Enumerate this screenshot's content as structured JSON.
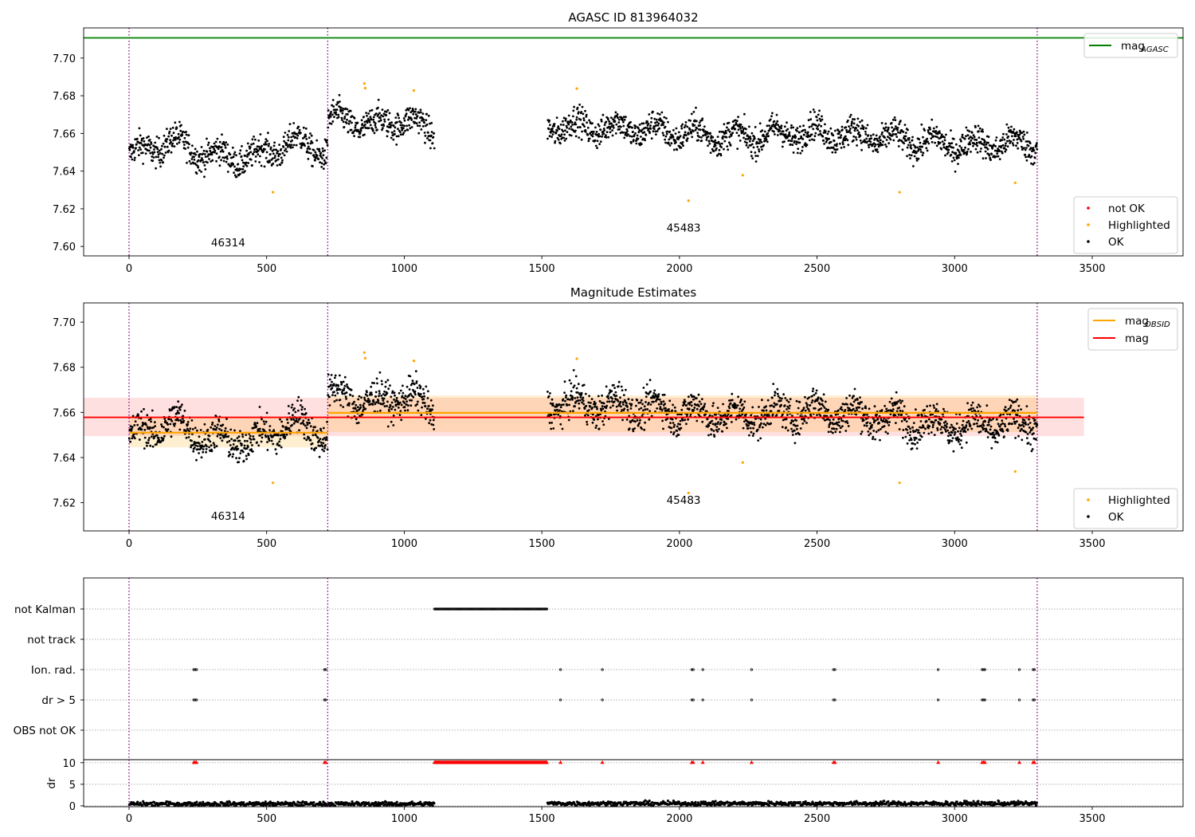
{
  "chart_data": [
    {
      "type": "scatter",
      "title": "AGASC ID 813964032",
      "xlim": [
        -165,
        3830
      ],
      "ylim": [
        7.595,
        7.716
      ],
      "xticks": [
        0,
        500,
        1000,
        1500,
        2000,
        2500,
        3000,
        3500
      ],
      "yticks": [
        7.6,
        7.62,
        7.64,
        7.66,
        7.68,
        7.7
      ],
      "ytick_labels": [
        "7.60",
        "7.62",
        "7.64",
        "7.66",
        "7.68",
        "7.70"
      ],
      "hlines": [
        {
          "name": "mag_AGASC",
          "y": 7.7107,
          "color": "#008000"
        }
      ],
      "obsid_boundaries": [
        0,
        722,
        3300
      ],
      "obsid_labels": [
        {
          "text": "46314",
          "x": 360,
          "y": 7.6
        },
        {
          "text": "45483",
          "x": 2015,
          "y": 7.608
        }
      ],
      "data_segments": [
        {
          "x": [
            0,
            722
          ],
          "mean": 7.6515,
          "spread": 0.0065,
          "drift": [
            [
              0,
              7.648
            ],
            [
              150,
              7.656
            ],
            [
              300,
              7.648
            ],
            [
              450,
              7.647
            ],
            [
              600,
              7.656
            ],
            [
              722,
              7.65
            ]
          ]
        },
        {
          "x": [
            722,
            1110
          ],
          "mean": 7.666,
          "spread": 0.0065,
          "drift": [
            [
              722,
              7.668
            ],
            [
              900,
              7.664
            ],
            [
              1000,
              7.668
            ],
            [
              1110,
              7.66
            ]
          ]
        },
        {
          "x": [
            1520,
            3300
          ],
          "mean": 7.6595,
          "spread": 0.0065,
          "drift": [
            [
              1520,
              7.664
            ],
            [
              1800,
              7.663
            ],
            [
              2200,
              7.658
            ],
            [
              2500,
              7.661
            ],
            [
              3000,
              7.654
            ],
            [
              3300,
              7.655
            ]
          ]
        }
      ],
      "highlighted_points": [
        [
          855,
          7.6865
        ],
        [
          858,
          7.684
        ],
        [
          1035,
          7.6828
        ],
        [
          1627,
          7.6838
        ],
        [
          523,
          7.6288
        ],
        [
          2033,
          7.6243
        ],
        [
          2230,
          7.6378
        ],
        [
          2800,
          7.6288
        ],
        [
          3220,
          7.6338
        ]
      ],
      "legend": {
        "position": "top-right",
        "entries": [
          {
            "label": "mag",
            "sub": "AGASC",
            "color": "#008000",
            "kind": "line"
          }
        ]
      },
      "legend2": {
        "position": "bottom-right",
        "entries": [
          {
            "label": "not OK",
            "color": "#ff0000",
            "kind": "marker"
          },
          {
            "label": "Highlighted",
            "color": "#ffa500",
            "kind": "marker"
          },
          {
            "label": "OK",
            "color": "#000000",
            "kind": "marker"
          }
        ]
      }
    },
    {
      "type": "scatter",
      "title": "Magnitude Estimates",
      "xlim": [
        -165,
        3830
      ],
      "ylim": [
        7.6075,
        7.7085
      ],
      "xticks": [
        0,
        500,
        1000,
        1500,
        2000,
        2500,
        3000,
        3500
      ],
      "yticks": [
        7.62,
        7.64,
        7.66,
        7.68,
        7.7
      ],
      "ytick_labels": [
        "7.62",
        "7.64",
        "7.66",
        "7.68",
        "7.70"
      ],
      "obsid_boundaries": [
        0,
        722,
        3300
      ],
      "obsid_labels": [
        {
          "text": "46314",
          "x": 360,
          "y": 7.6125
        },
        {
          "text": "45483",
          "x": 2015,
          "y": 7.6195
        }
      ],
      "mag": {
        "value": 7.6578,
        "band": [
          7.6495,
          7.6665
        ],
        "x": [
          -165,
          3470
        ],
        "color": "#ff0000"
      },
      "mag_obsid": [
        {
          "x": [
            0,
            722
          ],
          "value": 7.651,
          "band": [
            7.6445,
            7.6575
          ]
        },
        {
          "x": [
            722,
            3300
          ],
          "value": 7.6598,
          "band": [
            7.6513,
            7.6675
          ]
        }
      ],
      "legend": {
        "position": "top-right",
        "entries": [
          {
            "label": "mag",
            "sub": "OBSID",
            "color": "#ffa500",
            "kind": "line"
          },
          {
            "label": "mag",
            "sub": "",
            "color": "#ff0000",
            "kind": "line"
          }
        ]
      },
      "legend2": {
        "position": "bottom-right",
        "entries": [
          {
            "label": "Highlighted",
            "color": "#ffa500",
            "kind": "marker"
          },
          {
            "label": "OK",
            "color": "#000000",
            "kind": "marker"
          }
        ]
      }
    },
    {
      "type": "scatter",
      "title": "",
      "xlim": [
        -165,
        3830
      ],
      "flag_rows": [
        "not Kalman",
        "not track",
        "Ion. rad.",
        "dr > 5",
        "OBS not OK"
      ],
      "flags": {
        "not Kalman": {
          "ranges": [
            [
              1110,
              1520
            ]
          ],
          "points": []
        },
        "not track": {
          "ranges": [],
          "points": []
        },
        "Ion. rad.": {
          "ranges": [],
          "points": [
            235,
            240,
            245,
            710,
            715,
            1568,
            1720,
            2045,
            2050,
            2085,
            2262,
            2560,
            2565,
            2940,
            3100,
            3105,
            3110,
            3235,
            3285,
            3290
          ]
        },
        "dr > 5": {
          "ranges": [],
          "points": [
            235,
            240,
            245,
            710,
            715,
            1568,
            1720,
            2045,
            2050,
            2085,
            2262,
            2560,
            2565,
            2940,
            3100,
            3105,
            3110,
            3235,
            3285,
            3290
          ]
        },
        "OBS not OK": {
          "ranges": [],
          "points": []
        }
      },
      "obsid_boundaries": [
        0,
        722,
        3300
      ]
    },
    {
      "type": "scatter",
      "title": "",
      "ylabel": "dr",
      "xlim": [
        -165,
        3830
      ],
      "ylim": [
        -0.2,
        10.7
      ],
      "xticks": [
        0,
        500,
        1000,
        1500,
        2000,
        2500,
        3000,
        3500
      ],
      "yticks": [
        0,
        5,
        10
      ],
      "clip_value": 10,
      "segments": [
        {
          "x": [
            0,
            1110
          ],
          "mean": 0.45
        },
        {
          "x": [
            1520,
            3300
          ],
          "mean": 0.55
        }
      ],
      "clipped_ranges": [
        [
          1110,
          1520
        ]
      ],
      "clipped_points": [
        235,
        240,
        245,
        710,
        715,
        1568,
        1720,
        2045,
        2050,
        2085,
        2262,
        2560,
        2565,
        2940,
        3100,
        3105,
        3110,
        3235,
        3285,
        3290
      ],
      "obsid_boundaries": [
        0,
        722,
        3300
      ]
    }
  ]
}
